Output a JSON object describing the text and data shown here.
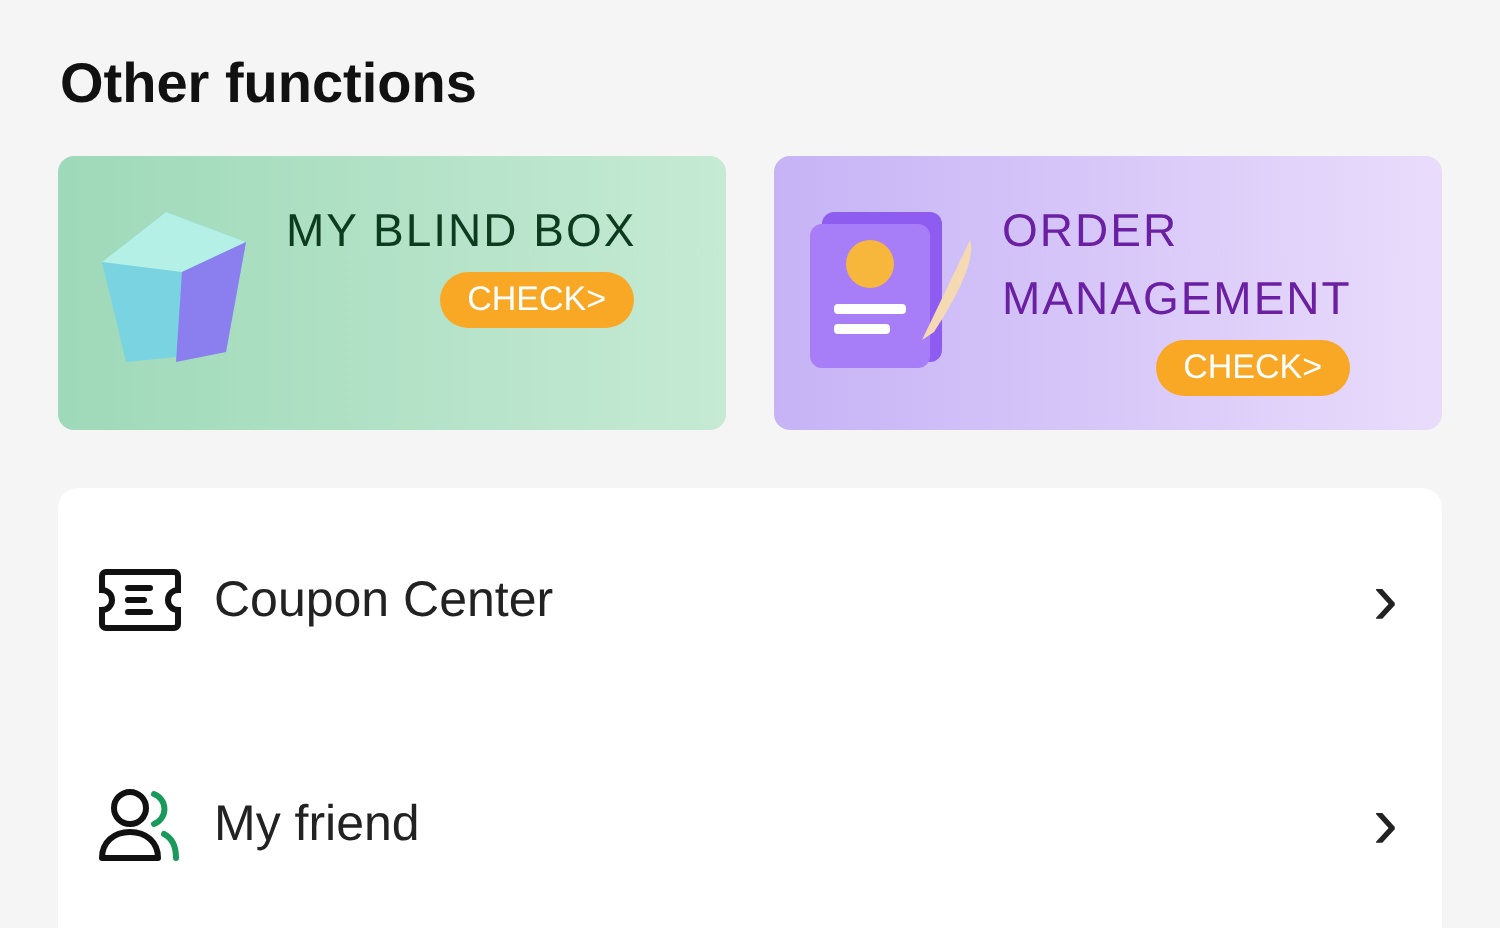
{
  "section_title": "Other functions",
  "cards": [
    {
      "kind": "blind-box",
      "title": "MY BLIND BOX",
      "button": "CHECK>"
    },
    {
      "kind": "order",
      "title": "ORDER MANAGEMENT",
      "button": "CHECK>"
    }
  ],
  "menu": [
    {
      "kind": "coupon",
      "label": "Coupon Center",
      "arrow": "›"
    },
    {
      "kind": "friend",
      "label": "My friend",
      "arrow": "›"
    }
  ]
}
